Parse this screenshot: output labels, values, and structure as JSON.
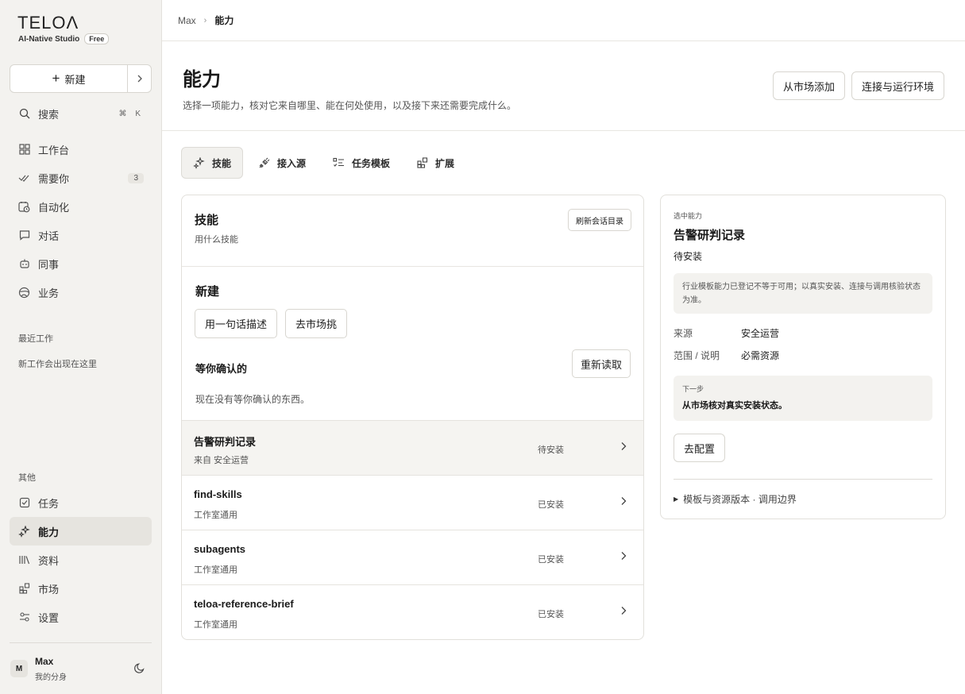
{
  "brand": {
    "logo": "TELOΛ",
    "subtitle": "AI-Native Studio",
    "plan": "Free"
  },
  "sidebar": {
    "new_label": "新建",
    "search_label": "搜索",
    "search_shortcut": "⌘ K",
    "nav_main": [
      {
        "label": "工作台",
        "icon": "grid-icon"
      },
      {
        "label": "需要你",
        "icon": "double-check-icon",
        "count": "3"
      },
      {
        "label": "自动化",
        "icon": "calendar-clock-icon"
      },
      {
        "label": "对话",
        "icon": "chat-bubble-icon"
      },
      {
        "label": "同事",
        "icon": "robot-icon"
      },
      {
        "label": "业务",
        "icon": "globe-icon"
      }
    ],
    "recent_label": "最近工作",
    "recent_empty": "新工作会出现在这里",
    "other_label": "其他",
    "nav_other": [
      {
        "label": "任务",
        "icon": "checkbox-icon"
      },
      {
        "label": "能力",
        "icon": "sparkle-icon"
      },
      {
        "label": "资料",
        "icon": "library-icon"
      },
      {
        "label": "市场",
        "icon": "blocks-icon"
      },
      {
        "label": "设置",
        "icon": "sliders-icon"
      }
    ],
    "user": {
      "initial": "M",
      "name": "Max",
      "subtitle": "我的分身"
    }
  },
  "breadcrumb": {
    "root": "Max",
    "current": "能力"
  },
  "header": {
    "title": "能力",
    "description": "选择一项能力，核对它来自哪里、能在何处使用，以及接下来还需要完成什么。",
    "btn_market_add": "从市场添加",
    "btn_connect_env": "连接与运行环境"
  },
  "tabs": [
    {
      "label": "技能",
      "icon": "sparkle-icon",
      "active": true
    },
    {
      "label": "接入源",
      "icon": "plug-icon",
      "active": false
    },
    {
      "label": "任务模板",
      "icon": "checklist-icon",
      "active": false
    },
    {
      "label": "扩展",
      "icon": "blocks-icon",
      "active": false
    }
  ],
  "skills_card": {
    "title": "技能",
    "subtitle": "用什么技能",
    "refresh_label": "刷新会话目录",
    "new_title": "新建",
    "btn_describe": "用一句话描述",
    "btn_market": "去市场挑",
    "confirm_title": "等你确认的",
    "btn_reload": "重新读取",
    "confirm_empty": "现在没有等你确认的东西。",
    "items": [
      {
        "name": "告警研判记录",
        "source": "来自 安全运营",
        "status": "待安装",
        "selected": true
      },
      {
        "name": "find-skills",
        "source": "工作室通用",
        "status": "已安装",
        "selected": false
      },
      {
        "name": "subagents",
        "source": "工作室通用",
        "status": "已安装",
        "selected": false
      },
      {
        "name": "teloa-reference-brief",
        "source": "工作室通用",
        "status": "已安装",
        "selected": false
      }
    ]
  },
  "detail": {
    "label": "选中能力",
    "title": "告警研判记录",
    "status": "待安装",
    "note": "行业模板能力已登记不等于可用；以真实安装、连接与调用核验状态为准。",
    "source_key": "来源",
    "source_val": "安全运营",
    "scope_key": "范围 / 说明",
    "scope_val": "必需资源",
    "next_label": "下一步",
    "next_text": "从市场核对真实安装状态。",
    "btn_configure": "去配置",
    "details_summary": "模板与资源版本 · 调用边界"
  }
}
